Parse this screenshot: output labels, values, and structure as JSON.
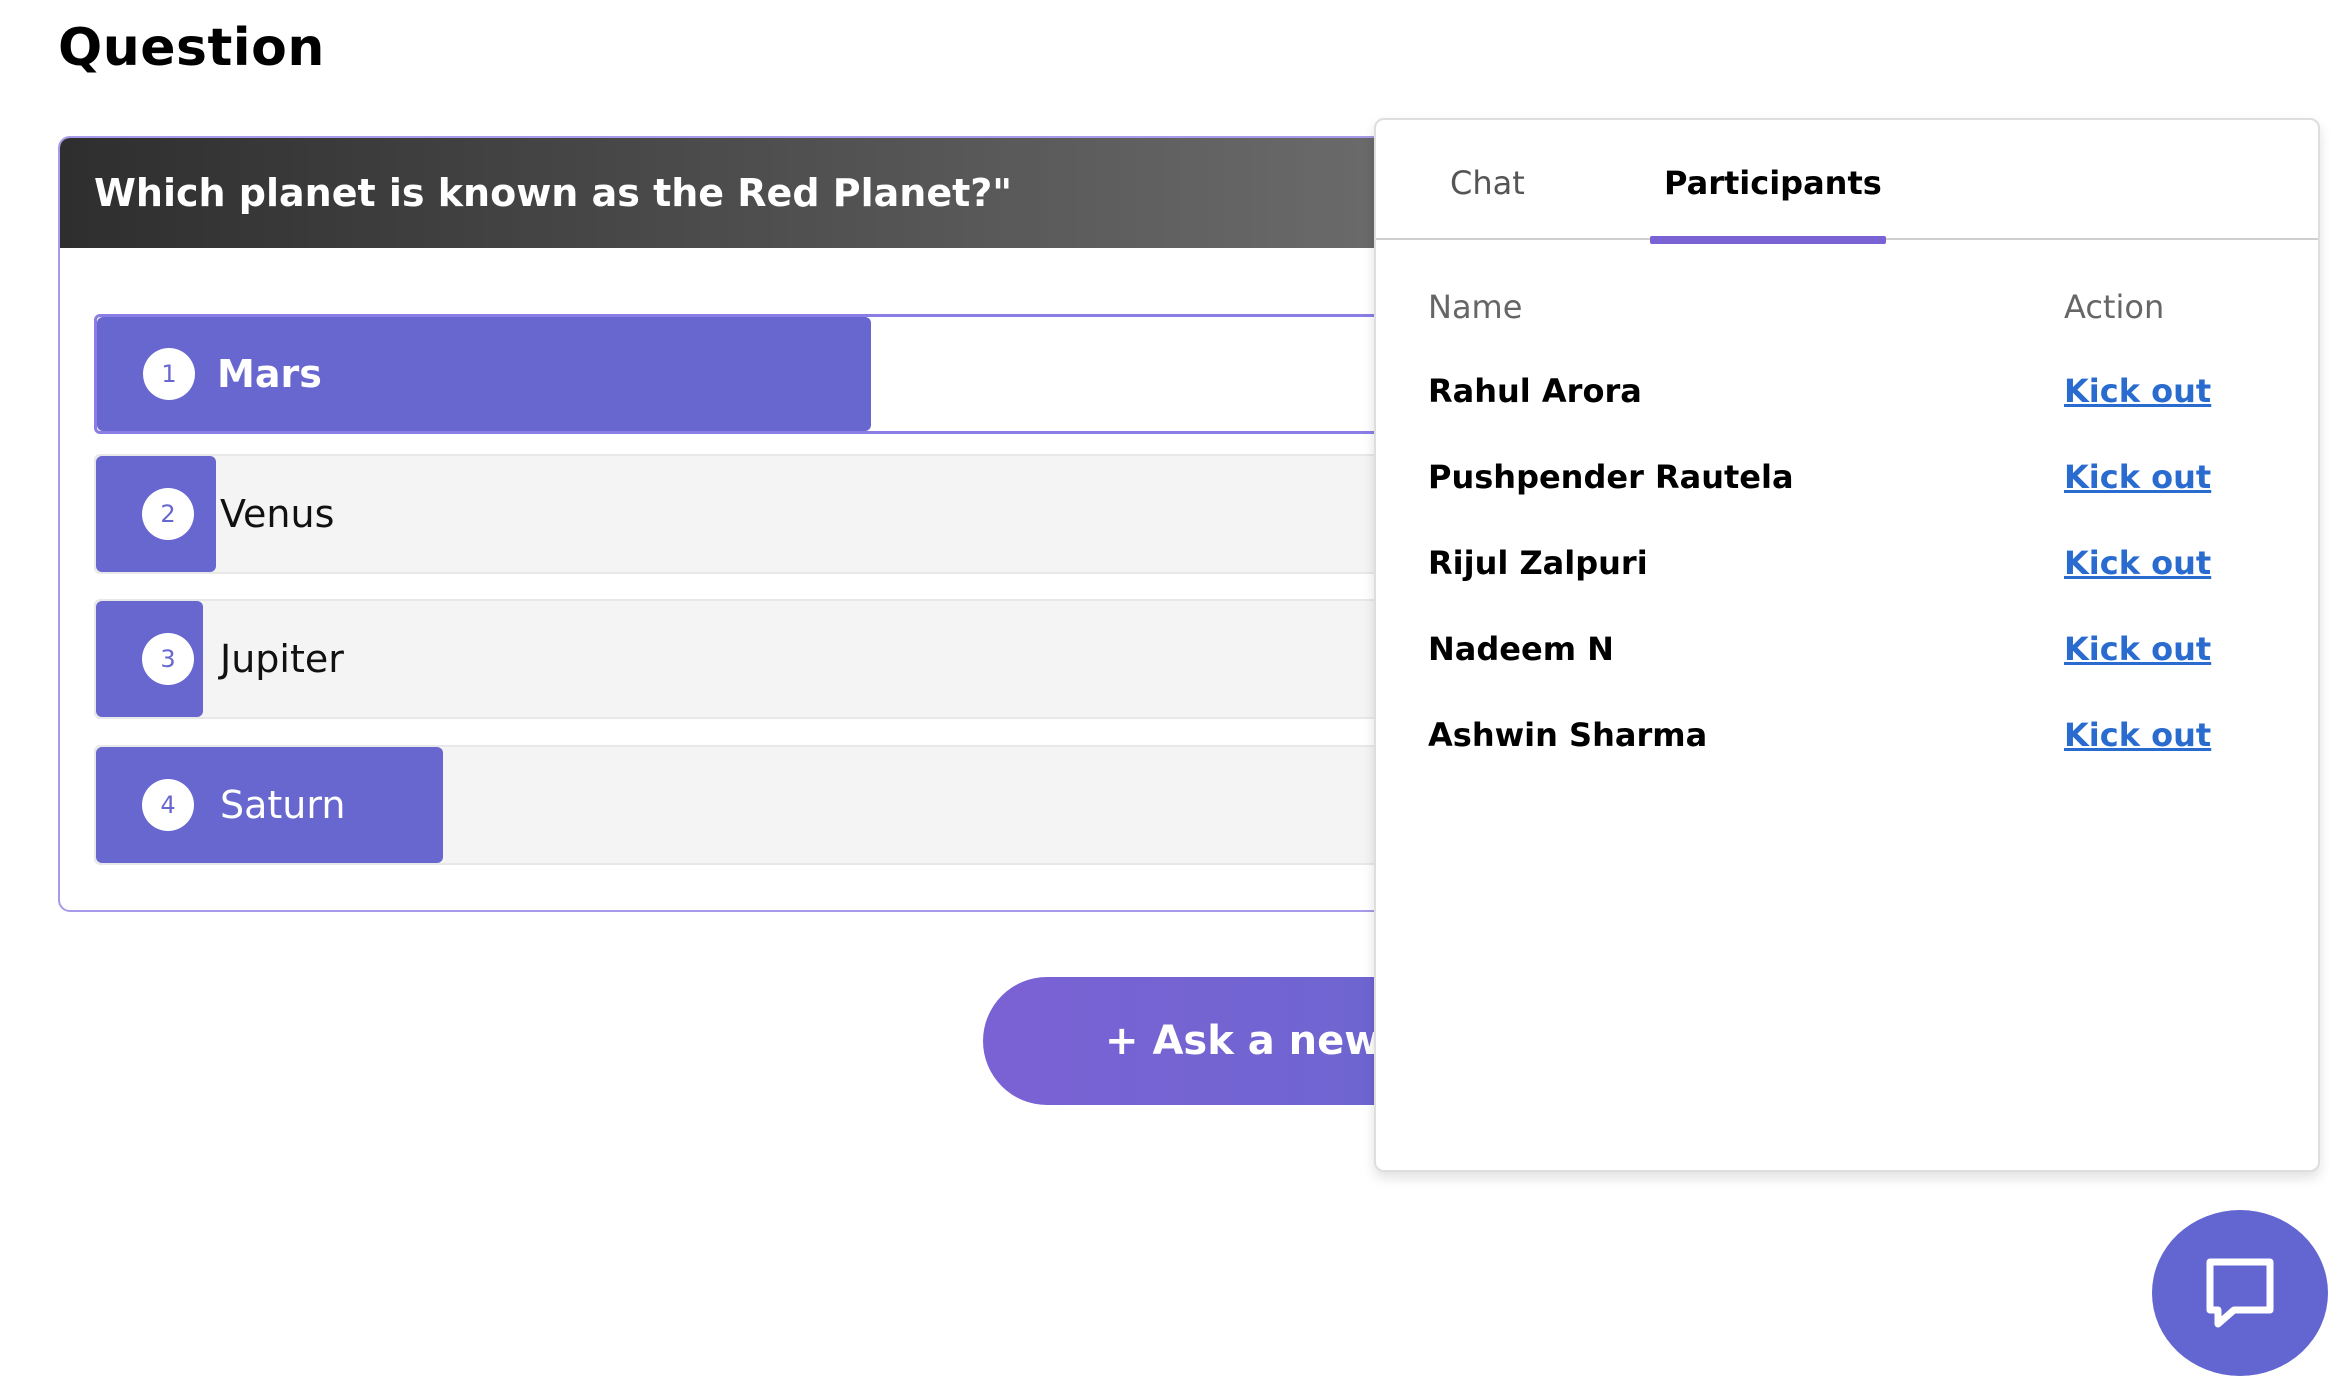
{
  "page": {
    "title": "Question"
  },
  "question": {
    "text": "Which planet is known as the Red Planet?\"",
    "options": [
      {
        "number": "1",
        "label": "Mars",
        "fill_fraction": 0.58
      },
      {
        "number": "2",
        "label": "Venus",
        "fill_fraction": 0.09
      },
      {
        "number": "3",
        "label": "Jupiter",
        "fill_fraction": 0.08
      },
      {
        "number": "4",
        "label": "Saturn",
        "fill_fraction": 0.26
      }
    ]
  },
  "actions": {
    "ask_new_question": "+ Ask a new q"
  },
  "panel": {
    "tabs": [
      {
        "label": "Chat",
        "active": false
      },
      {
        "label": "Participants",
        "active": true
      }
    ],
    "columns": {
      "name": "Name",
      "action": "Action"
    },
    "participants": [
      {
        "name": "Rahul Arora",
        "action": "Kick out"
      },
      {
        "name": "Pushpender Rautela",
        "action": "Kick out"
      },
      {
        "name": "Rijul Zalpuri",
        "action": "Kick out"
      },
      {
        "name": "Nadeem N",
        "action": "Kick out"
      },
      {
        "name": "Ashwin Sharma",
        "action": "Kick out"
      }
    ]
  },
  "icons": {
    "chat_fab": "chat-bubble-icon"
  },
  "colors": {
    "accent": "#6767cf",
    "tab_underline": "#7b62d4",
    "link": "#2a6bd0",
    "header_dark": "#2e2e2e"
  }
}
